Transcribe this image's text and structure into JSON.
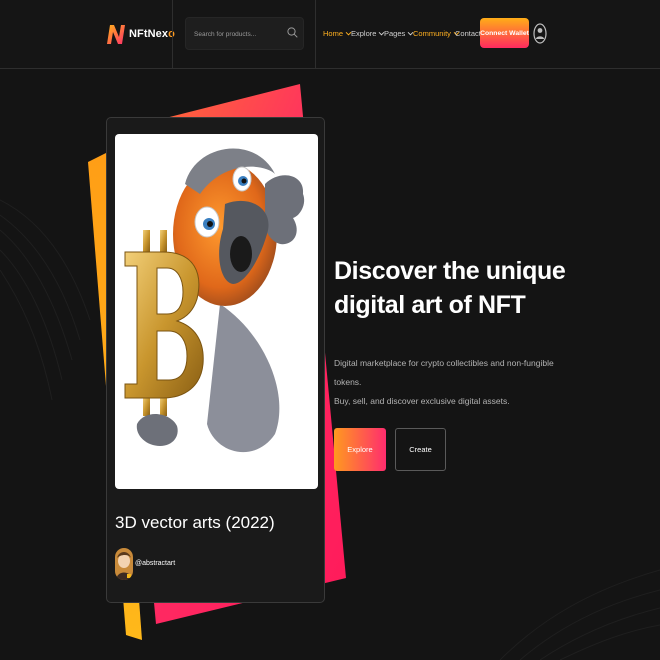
{
  "brand": {
    "name_prefix": "NFtNex",
    "name_suffix": "o"
  },
  "search": {
    "placeholder": "Search for products..."
  },
  "nav": {
    "home": "Home",
    "explore": "Explore",
    "pages": "Pages",
    "community": "Community",
    "contact": "Contact"
  },
  "header": {
    "connect_wallet": "Connect Wallet"
  },
  "card": {
    "title": "3D vector arts (2022)",
    "author": "@abstractart"
  },
  "hero": {
    "title_line1": "Discover the unique",
    "title_line2": "digital art of NFT",
    "desc_line1": "Digital marketplace for crypto collectibles and non-fungible tokens.",
    "desc_line2": "Buy, sell, and discover exclusive digital assets.",
    "explore": "Explore",
    "create": "Create"
  },
  "colors": {
    "background": "#141414",
    "accent_orange": "#ffae17",
    "accent_pink": "#ff2a5f",
    "active_nav": "#ffb020"
  },
  "icons": [
    "logo-mark-icon",
    "search-icon",
    "chevron-down-icon",
    "user-icon"
  ]
}
